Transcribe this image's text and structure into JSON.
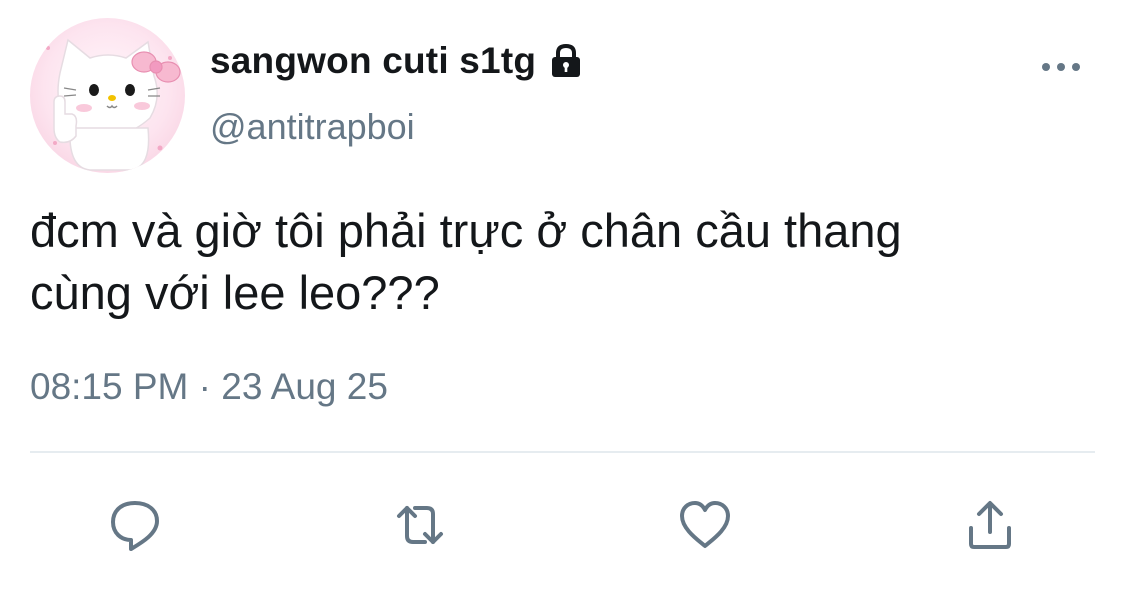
{
  "tweet": {
    "author": {
      "display_name": "sangwon cuti s1tg",
      "handle": "@antitrapboi",
      "protected_icon": "lock-icon",
      "avatar_icon": "hello-kitty-avatar"
    },
    "text": "đcm và giờ tôi phải trực ở chân cầu thang\ncùng với lee leo???",
    "time": "08:15 PM",
    "separator": " · ",
    "date": "23 Aug 25",
    "menu_icon": "more-options-icon"
  },
  "actions": [
    {
      "name": "reply",
      "icon": "reply-icon"
    },
    {
      "name": "retweet",
      "icon": "retweet-icon"
    },
    {
      "name": "like",
      "icon": "heart-icon"
    },
    {
      "name": "share",
      "icon": "share-icon"
    }
  ],
  "colors": {
    "text_primary": "#14171a",
    "text_secondary": "#657786",
    "icon": "#657786",
    "divider": "#e6ecf0"
  }
}
